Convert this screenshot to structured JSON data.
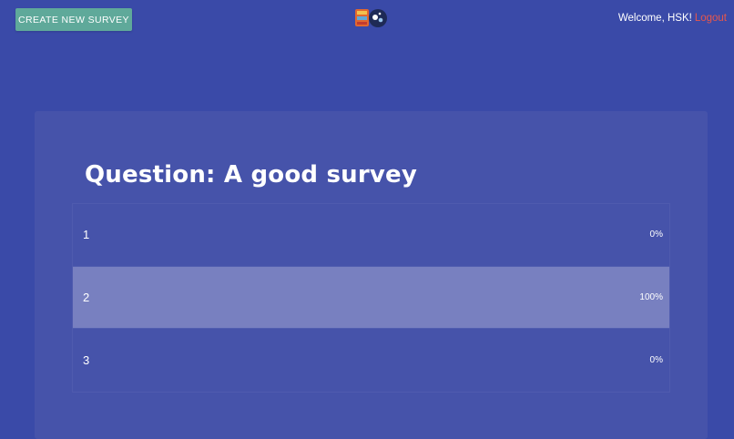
{
  "header": {
    "create_button_label": "CREATE NEW SURVEY",
    "welcome_text": "Welcome, HSK!",
    "logout_label": "Logout",
    "logo_icon": "app-logo-icon"
  },
  "survey": {
    "question_title": "Question: A good survey",
    "options": [
      {
        "label": "1",
        "percent_text": "0%",
        "fraction": 0
      },
      {
        "label": "2",
        "percent_text": "100%",
        "fraction": 1
      },
      {
        "label": "3",
        "percent_text": "0%",
        "fraction": 0
      }
    ]
  },
  "colors": {
    "background": "#3a4aa8",
    "card": "#4653aa",
    "button": "#5fa99a",
    "bar_fill": "#7880c0",
    "logout": "#e8574b"
  }
}
